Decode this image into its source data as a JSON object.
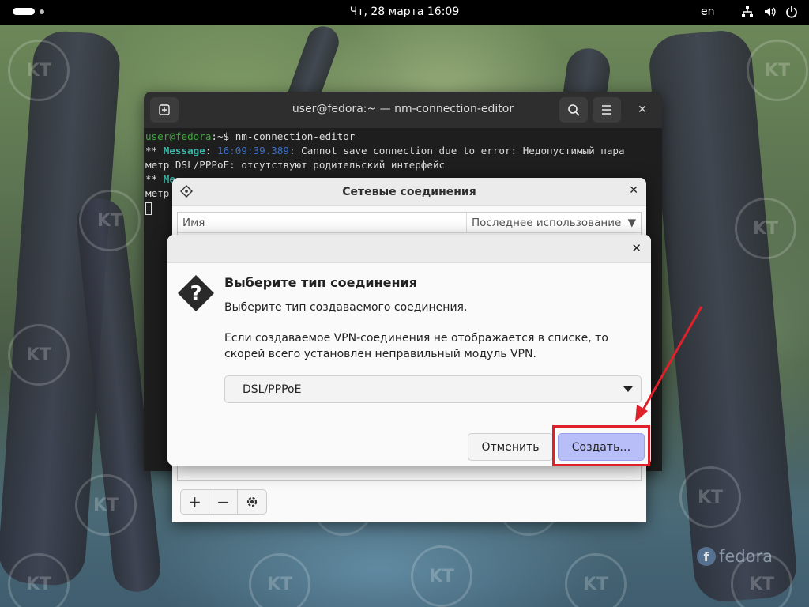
{
  "topbar": {
    "clock": "Чт, 28 марта  16:09",
    "language": "en"
  },
  "terminal": {
    "title": "user@fedora:~ — nm-connection-editor",
    "prompt_user": "user@fedora",
    "prompt_rest": ":~$ nm-connection-editor",
    "line1_star": "** ",
    "line1_label": "Message",
    "line1_time": "16:09:39.389",
    "line1_text": ": Cannot save connection due to error: Недопустимый пара",
    "line2_text": "метр DSL/PPPoE: отсутствуют родительский интерфейс",
    "line3_star": "** ",
    "line3_label": "Me",
    "line4_text": "метр"
  },
  "network_window": {
    "title": "Сетевые соединения",
    "columns": [
      "Имя",
      "Последнее использование"
    ]
  },
  "dialog": {
    "heading": "Выберите тип соединения",
    "subtitle": "Выберите тип создаваемого соединения.",
    "note": "Если создаваемое VPN-соединения не отображается в списке, то скорей всего установлен неправильный модуль VPN.",
    "selected_type": "DSL/PPPoE",
    "cancel_label": "Отменить",
    "create_label": "Создать…"
  },
  "watermark": "fedora",
  "accent_color": "#e0202a",
  "suggested_button_color": "#b8bff8"
}
